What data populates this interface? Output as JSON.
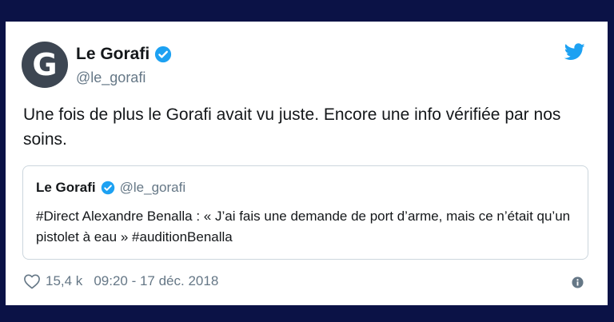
{
  "colors": {
    "background": "#0b1246",
    "card": "#ffffff",
    "verified": "#1da1f2",
    "twitter_bird": "#1da1f2",
    "secondary_text": "#657786"
  },
  "tweet": {
    "avatar_letter": "G",
    "author_name": "Le Gorafi",
    "author_handle": "@le_gorafi",
    "text": "Une fois de plus le Gorafi avait vu juste. Encore une info vérifiée par nos soins.",
    "likes": "15,4 k",
    "timestamp": "09:20 - 17 déc. 2018",
    "icons": [
      "verified-badge-icon",
      "twitter-bird-icon",
      "heart-icon",
      "info-icon"
    ]
  },
  "quoted_tweet": {
    "author_name": "Le Gorafi",
    "author_handle": "@le_gorafi",
    "text": "#Direct Alexandre Benalla : « J’ai fais une demande de port d’arme, mais ce n’était qu’un pistolet à eau » #auditionBenalla"
  }
}
